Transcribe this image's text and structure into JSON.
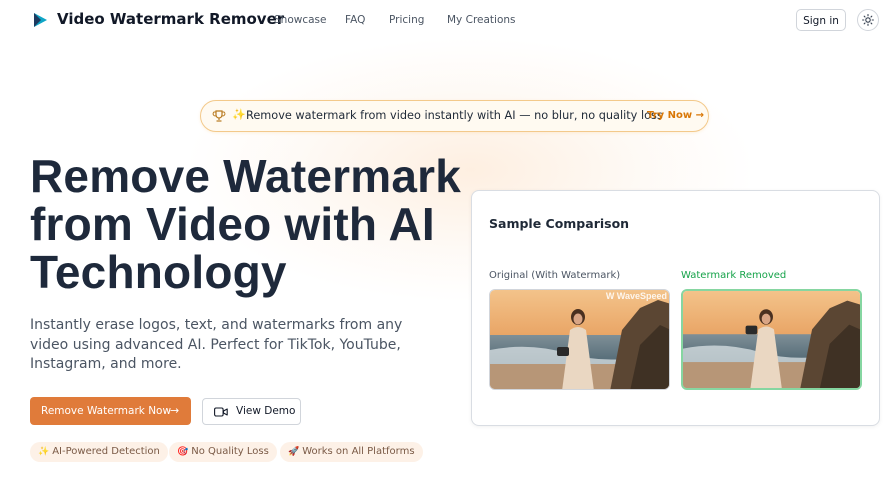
{
  "header": {
    "brand": "Video Watermark Remover",
    "logo_icon": "play-triangle-icon",
    "nav": [
      "Showcase",
      "FAQ",
      "Pricing",
      "My Creations"
    ],
    "signin_label": "Sign in",
    "theme_icon": "sun-icon"
  },
  "announcement": {
    "icon": "trophy-icon",
    "sparkle": "✨",
    "text": "Remove watermark from video instantly with AI — no blur, no quality loss",
    "cta": "Try Now →"
  },
  "hero": {
    "title_lines": [
      "Remove Watermark",
      "from Video with AI",
      "Technology"
    ],
    "subtitle": "Instantly erase logos, text, and watermarks from any video using advanced AI. Perfect for TikTok, YouTube, Instagram, and more.",
    "primary_button": "Remove Watermark Now",
    "primary_arrow": "→",
    "secondary_button": "View Demo",
    "secondary_icon": "video-camera-icon",
    "tags": [
      {
        "icon": "✨",
        "label": "AI-Powered Detection"
      },
      {
        "icon": "🎯",
        "label": "No Quality Loss"
      },
      {
        "icon": "🚀",
        "label": "Works on All Platforms"
      }
    ]
  },
  "comparison": {
    "title": "Sample Comparison",
    "original_caption": "Original (With Watermark)",
    "removed_caption": "Watermark Removed",
    "watermark_text": "W WaveSpeed",
    "accent_green": "#16a34a",
    "primary_orange": "#e07b3a"
  }
}
